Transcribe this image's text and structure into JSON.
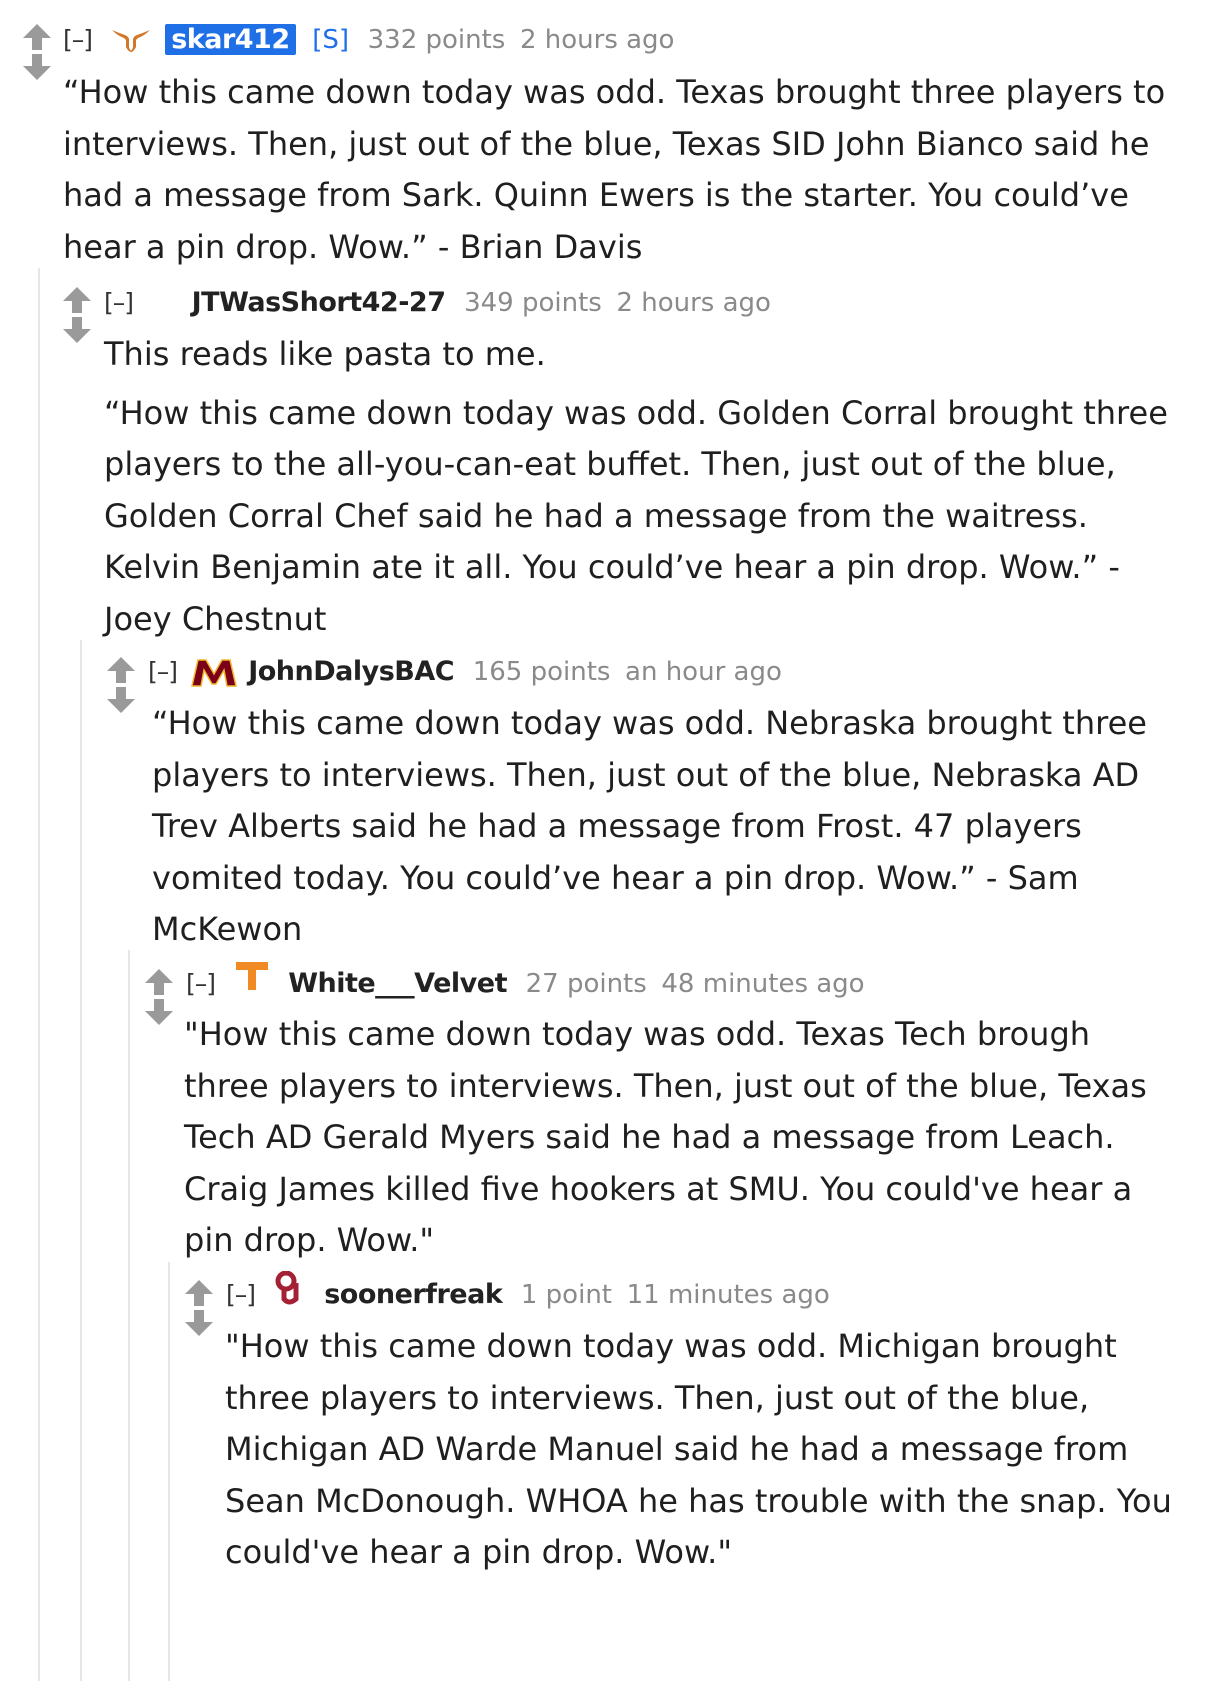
{
  "comments": [
    {
      "collapse": "[–]",
      "author": "skar412",
      "submitter": "[S]",
      "points": "332 points",
      "time": "2 hours ago",
      "flair": "longhorn-logo",
      "body": [
        "“How this came down today was odd. Texas brought three players to interviews. Then, just out of the blue, Texas SID John Bianco said he had a message from Sark. Quinn Ewers is the starter. You could’ve hear a pin drop. Wow.” - Brian Davis"
      ]
    },
    {
      "collapse": "[–]",
      "author": "JTWasShort42-27",
      "points": "349 points",
      "time": "2 hours ago",
      "body": [
        "This reads like pasta to me.",
        "“How this came down today was odd. Golden Corral brought three players to the all-you-can-eat buffet. Then, just out of the blue, Golden Corral Chef said he had a message from the waitress. Kelvin Benjamin ate it all. You could’ve hear a pin drop. Wow.” - Joey Chestnut"
      ]
    },
    {
      "collapse": "[–]",
      "author": "JohnDalysBAC",
      "points": "165 points",
      "time": "an hour ago",
      "flair": "minnesota-m-logo",
      "body": [
        "“How this came down today was odd. Nebraska brought three players to interviews. Then, just out of the blue, Nebraska AD Trev Alberts said he had a message from Frost. 47 players vomited today. You could’ve hear a pin drop. Wow.” - Sam McKewon"
      ]
    },
    {
      "collapse": "[–]",
      "author": "White___Velvet",
      "points": "27 points",
      "time": "48 minutes ago",
      "flair": "tennessee-t-logo",
      "body": [
        "\"How this came down today was odd. Texas Tech brough three players to interviews. Then, just out of the blue, Texas Tech AD Gerald Myers said he had a message from Leach. Craig James killed five hookers at SMU. You could've hear a pin drop. Wow.\""
      ]
    },
    {
      "collapse": "[–]",
      "author": "soonerfreak",
      "points": "1 point",
      "time": "11 minutes ago",
      "flair": "oklahoma-ou-logo",
      "body": [
        "\"How this came down today was odd. Michigan brought three players to interviews. Then, just out of the blue, Michigan AD Warde Manuel said he had a message from Sean McDonough. WHOA he has trouble with the snap. You could've hear a pin drop. Wow.\""
      ]
    }
  ],
  "colors": {
    "op_highlight": "#1f6fe6",
    "meta": "#8a8a8a",
    "thread_line": "#e6e6e6"
  }
}
